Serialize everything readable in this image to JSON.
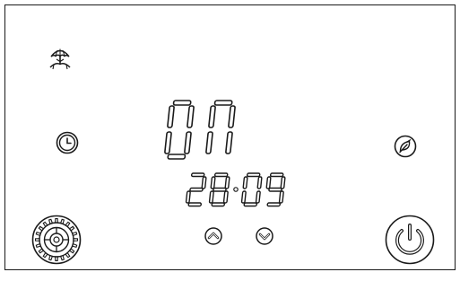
{
  "display": {
    "mode_text": "ON",
    "time_text": "28:09",
    "time_hours": "28",
    "time_minutes": "09"
  },
  "icons": {
    "beach": "umbrella-beach-icon",
    "clock": "clock-icon",
    "eco": "leaf-icon",
    "settings": "gear-icon",
    "up": "chevron-up-icon",
    "down": "chevron-down-icon",
    "power": "power-icon"
  },
  "colors": {
    "background": "#ffffff",
    "ink": "#1a1a1a"
  }
}
